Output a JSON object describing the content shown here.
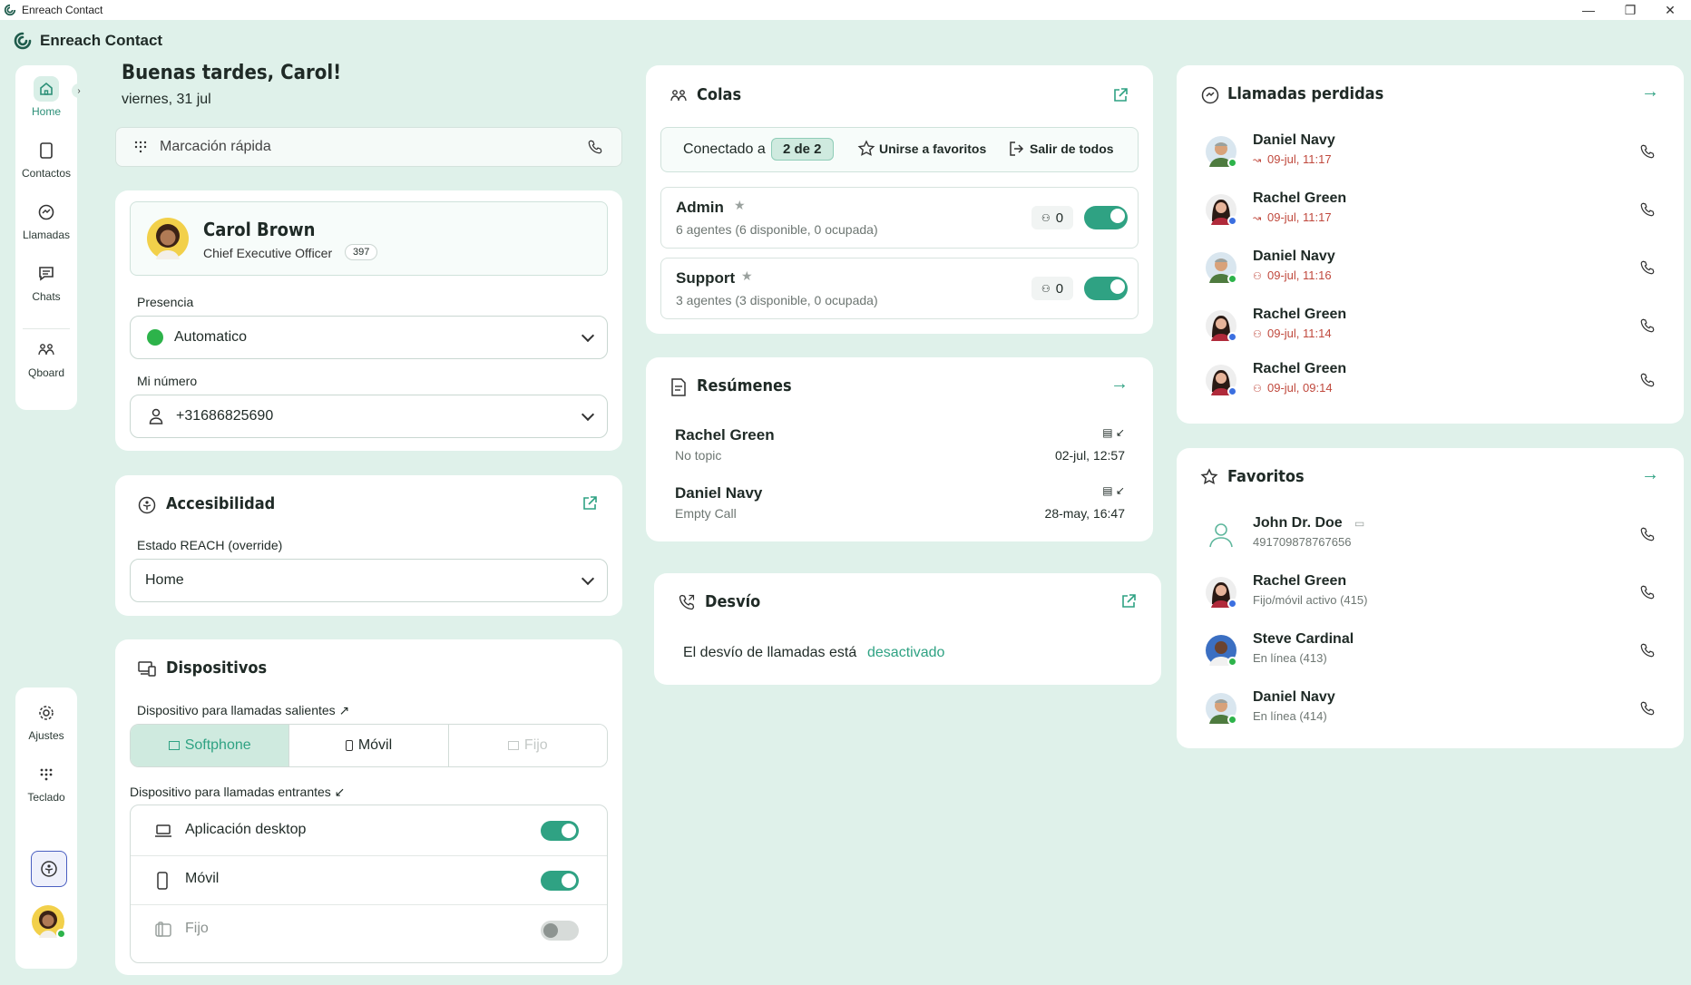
{
  "window": {
    "title": "Enreach Contact"
  },
  "app": {
    "name": "Enreach Contact"
  },
  "nav": {
    "home": "Home",
    "contacts": "Contactos",
    "calls": "Llamadas",
    "chats": "Chats",
    "qboard": "Qboard",
    "settings": "Ajustes",
    "keypad": "Teclado"
  },
  "greeting": {
    "title": "Buenas tardes, Carol!",
    "date": "viernes, 31 jul"
  },
  "quickdial": {
    "placeholder": "Marcación rápida"
  },
  "profile": {
    "name": "Carol Brown",
    "role": "Chief Executive Officer",
    "ext": "397",
    "presence_label": "Presencia",
    "presence_value": "Automatico",
    "number_label": "Mi número",
    "number_value": "+31686825690"
  },
  "accessibility": {
    "title": "Accesibilidad",
    "state_label": "Estado REACH (override)",
    "state_value": "Home"
  },
  "devices": {
    "title": "Dispositivos",
    "outgoing_label": "Dispositivo para llamadas salientes ↗",
    "out_softphone": "Softphone",
    "out_mobile": "Móvil",
    "out_fixed": "Fijo",
    "incoming_label": "Dispositivo para llamadas entrantes ↙",
    "in_desktop": "Aplicación desktop",
    "in_mobile": "Móvil",
    "in_fixed": "Fijo"
  },
  "queues": {
    "title": "Colas",
    "connected_prefix": "Conectado a",
    "connected_badge": "2 de 2",
    "join_favorites": "Unirse a favoritos",
    "leave_all": "Salir de todos",
    "items": [
      {
        "name": "Admin",
        "agents": "6 agentes (6 disponible, 0 ocupada)",
        "count": "0"
      },
      {
        "name": "Support",
        "agents": "3 agentes (3 disponible, 0 ocupada)",
        "count": "0"
      }
    ]
  },
  "summaries": {
    "title": "Resúmenes",
    "items": [
      {
        "name": "Rachel Green",
        "topic": "No topic",
        "time": "02-jul, 12:57"
      },
      {
        "name": "Daniel Navy",
        "topic": "Empty Call",
        "time": "28-may, 16:47"
      }
    ]
  },
  "forwarding": {
    "title": "Desvío",
    "text": "El desvío de llamadas está",
    "status": "desactivado"
  },
  "missed": {
    "title": "Llamadas perdidas",
    "items": [
      {
        "name": "Daniel Navy",
        "time": "09-jul, 11:17"
      },
      {
        "name": "Rachel Green",
        "time": "09-jul, 11:17"
      },
      {
        "name": "Daniel Navy",
        "time": "09-jul, 11:16"
      },
      {
        "name": "Rachel Green",
        "time": "09-jul, 11:14"
      },
      {
        "name": "Rachel Green",
        "time": "09-jul, 09:14"
      }
    ]
  },
  "favorites": {
    "title": "Favoritos",
    "items": [
      {
        "name": "John Dr. Doe",
        "sub": "491709878767656"
      },
      {
        "name": "Rachel Green",
        "sub": "Fijo/móvil activo (415)"
      },
      {
        "name": "Steve Cardinal",
        "sub": "En línea (413)"
      },
      {
        "name": "Daniel Navy",
        "sub": "En línea (414)"
      }
    ]
  },
  "colors": {
    "accent": "#2fa283",
    "background": "#dff1ea",
    "missed_red": "#c0493d",
    "status_green": "#2db34a",
    "status_blue": "#3b6fe0"
  }
}
